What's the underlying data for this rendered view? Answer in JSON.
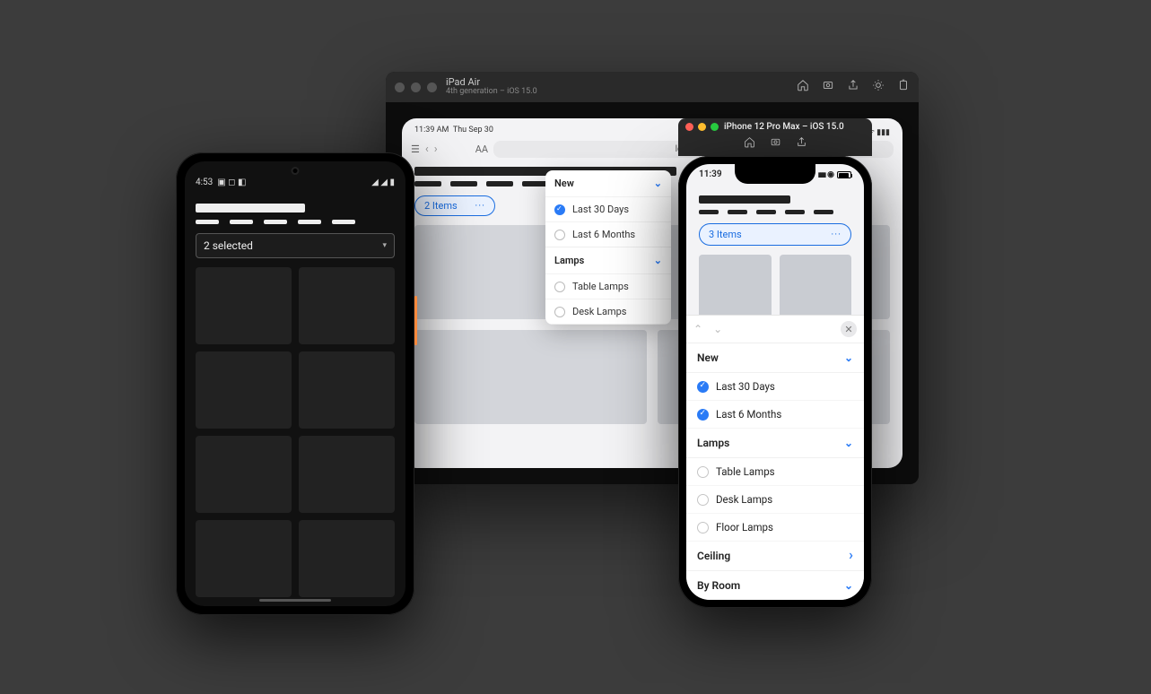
{
  "ipad_window": {
    "title": "iPad Air",
    "subtitle": "4th generation – iOS 15.0",
    "statusbar": {
      "time": "11:39 AM",
      "date": "Thu Sep 30"
    },
    "toolbar": {
      "aa": "AA",
      "address": "localhost"
    },
    "filter_chip": {
      "label": "2 Items",
      "more": "···"
    },
    "popover": {
      "sections": [
        {
          "title": "New",
          "options": [
            {
              "label": "Last 30 Days",
              "selected": true
            },
            {
              "label": "Last 6 Months",
              "selected": false
            }
          ]
        },
        {
          "title": "Lamps",
          "options": [
            {
              "label": "Table Lamps",
              "selected": false
            },
            {
              "label": "Desk Lamps",
              "selected": false
            }
          ]
        }
      ]
    }
  },
  "android": {
    "status": {
      "time": "4:53",
      "icons": "◆ ◇ ◈"
    },
    "select": {
      "label": "2 selected"
    }
  },
  "iphone_window": {
    "title": "iPhone 12 Pro Max – iOS 15.0",
    "status": {
      "time": "11:39"
    },
    "filter_chip": {
      "label": "3 Items",
      "more": "···"
    },
    "sheet": {
      "sections": [
        {
          "title": "New",
          "expanded": true,
          "options": [
            {
              "label": "Last 30 Days",
              "selected": true
            },
            {
              "label": "Last 6 Months",
              "selected": true
            }
          ]
        },
        {
          "title": "Lamps",
          "expanded": true,
          "options": [
            {
              "label": "Table Lamps",
              "selected": false
            },
            {
              "label": "Desk Lamps",
              "selected": false
            },
            {
              "label": "Floor Lamps",
              "selected": false
            }
          ]
        },
        {
          "title": "Ceiling",
          "expanded": false,
          "chev": "right"
        },
        {
          "title": "By Room",
          "expanded": false,
          "chev": "down"
        }
      ]
    }
  }
}
